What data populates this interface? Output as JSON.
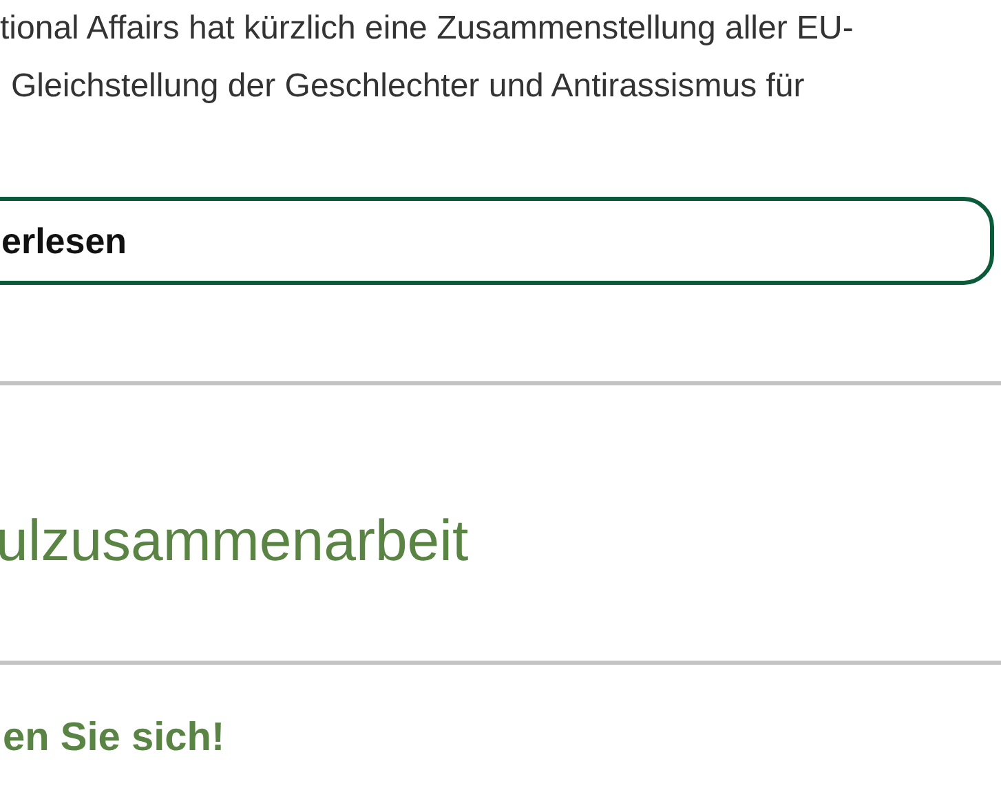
{
  "intro": {
    "lines": [
      "tional Affairs hat kürzlich eine Zusammenstellung aller EU-",
      "Gleichstellung der Geschlechter und Antirassismus für"
    ]
  },
  "read_more_button": {
    "label": "erlesen"
  },
  "section_heading": "ulzusammenarbeit",
  "subheading": "en Sie sich!"
}
